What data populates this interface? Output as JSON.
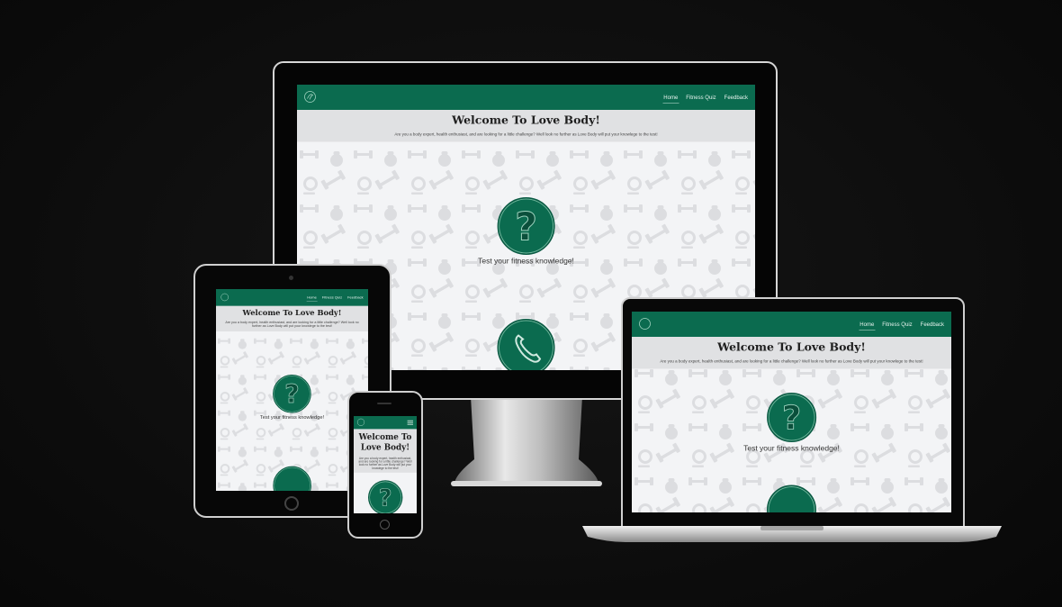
{
  "site": {
    "nav": {
      "logo": "logo-icon",
      "links": [
        "Home",
        "Fitness Quiz",
        "Feedback"
      ],
      "active": "Home",
      "menu_icon": "hamburger-icon"
    },
    "hero": {
      "title": "Welcome To Love Body!",
      "intro": "Are you a body expert, health enthusiast, and are looking for a little challenge? Well look no further as Love Body will put your knowlege to the test!"
    },
    "cards": [
      {
        "icon": "question-mark-icon",
        "label": "Test your fitness knowledge!"
      },
      {
        "icon": "phone-icon",
        "label": ""
      }
    ]
  },
  "colors": {
    "brand": "#0b6b4f",
    "background": "#0c0c0c",
    "hero": "#e0e1e3",
    "page": "#f3f4f6"
  }
}
